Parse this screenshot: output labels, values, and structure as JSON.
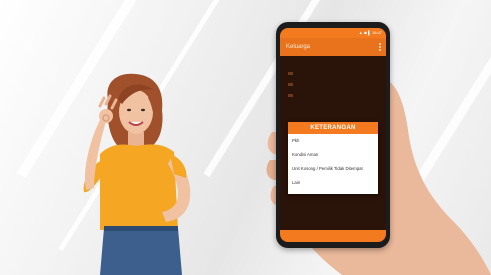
{
  "phone": {
    "status_text": "▲ ◆ ▌ 16:47",
    "app_title": "Keluarga",
    "dialog": {
      "title": "KETERANGAN",
      "options": [
        "Pkh",
        "Kondisi Aman",
        "Unit Kosong / Pemilik Tidak Ditempat",
        "Lain"
      ]
    }
  },
  "colors": {
    "accent_orange": "#f47a20",
    "app_background": "#2a1308",
    "shirt_yellow": "#f5a623"
  },
  "icons": [
    "overflow-menu-icon"
  ]
}
